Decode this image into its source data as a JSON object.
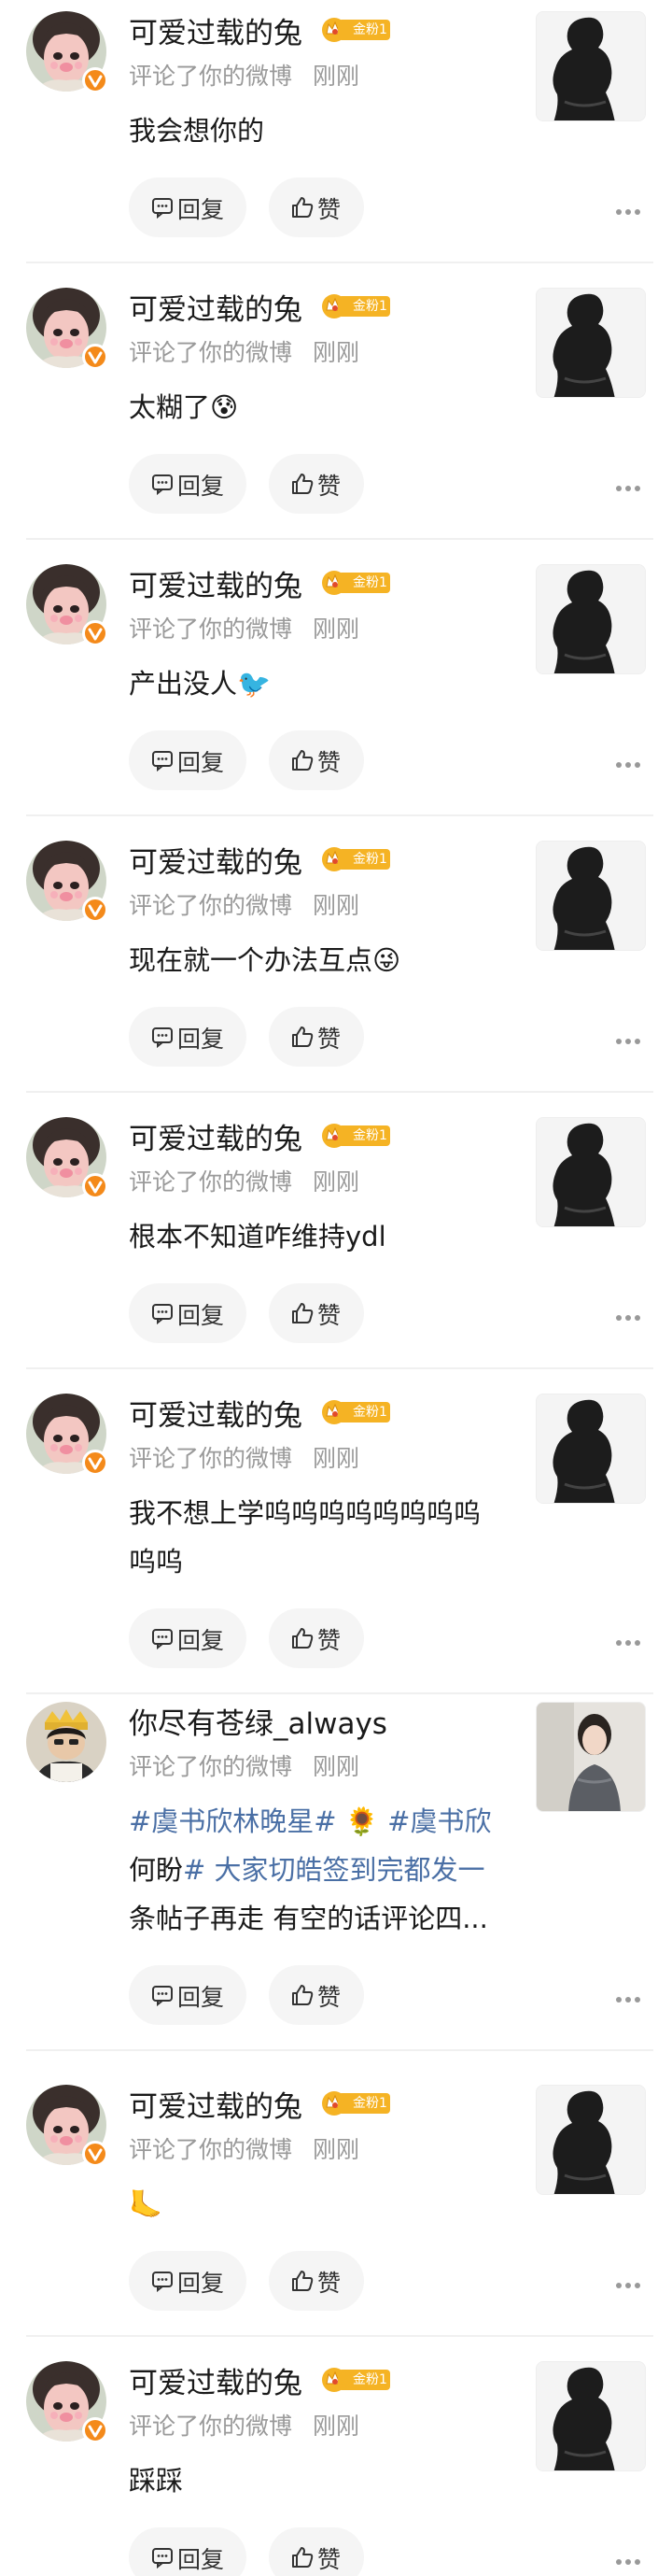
{
  "labels": {
    "action": "评论了你的微博",
    "time": "刚刚",
    "reply": "回复",
    "like": "赞",
    "fan_badge": "金粉1"
  },
  "colors": {
    "badge": "#f5b324",
    "verified": "#f48a1a",
    "topic": "#4a6fa5"
  },
  "notifications": [
    {
      "user": "可爱过载的兔",
      "avatar": "pink-girl-avatar",
      "has_fan_badge": true,
      "verified": true,
      "content": [
        "我会想你的"
      ],
      "thumb": "silhouette-thumbnail"
    },
    {
      "user": "可爱过载的兔",
      "avatar": "pink-girl-avatar",
      "has_fan_badge": true,
      "verified": true,
      "content": [
        "太糊了😰"
      ],
      "thumb": "silhouette-thumbnail"
    },
    {
      "user": "可爱过载的兔",
      "avatar": "pink-girl-avatar",
      "has_fan_badge": true,
      "verified": true,
      "content": [
        "产出没人🐦"
      ],
      "thumb": "silhouette-thumbnail"
    },
    {
      "user": "可爱过载的兔",
      "avatar": "pink-girl-avatar",
      "has_fan_badge": true,
      "verified": true,
      "content": [
        "现在就一个办法互点😜"
      ],
      "thumb": "silhouette-thumbnail"
    },
    {
      "user": "可爱过载的兔",
      "avatar": "pink-girl-avatar",
      "has_fan_badge": true,
      "verified": true,
      "content": [
        "根本不知道咋维持ydl"
      ],
      "thumb": "silhouette-thumbnail"
    },
    {
      "user": "可爱过载的兔",
      "avatar": "pink-girl-avatar",
      "has_fan_badge": true,
      "verified": true,
      "content": [
        "我不想上学呜呜呜呜呜呜呜呜",
        "呜呜"
      ],
      "thumb": "silhouette-thumbnail"
    },
    {
      "user": "你尽有苍绿_always",
      "avatar": "boy-with-hat-avatar",
      "has_fan_badge": false,
      "verified": false,
      "content": [
        "#虞书欣林晚星# 🌻 #虞书欣",
        "何盼# 大家切皓签到完都发一",
        "条帖子再走 有空的话评论四..."
      ],
      "thumb": "photo-thumbnail"
    },
    {
      "user": "可爱过载的兔",
      "avatar": "pink-girl-avatar",
      "has_fan_badge": true,
      "verified": true,
      "content": [
        "🦶"
      ],
      "thumb": "silhouette-thumbnail"
    },
    {
      "user": "可爱过载的兔",
      "avatar": "pink-girl-avatar",
      "has_fan_badge": true,
      "verified": true,
      "content": [
        "踩踩"
      ],
      "thumb": "silhouette-thumbnail"
    }
  ]
}
